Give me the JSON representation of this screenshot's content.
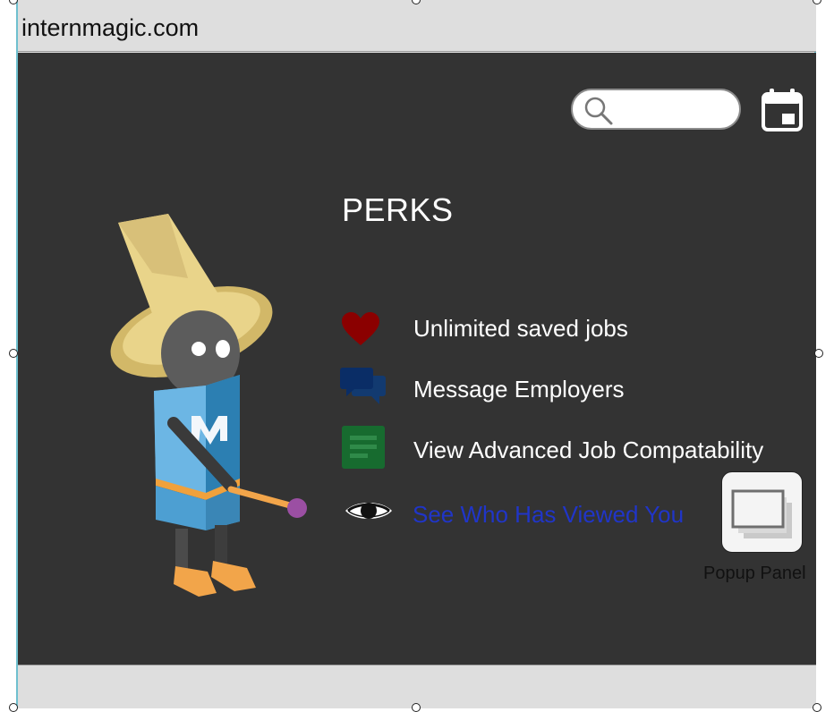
{
  "browser": {
    "url": "internmagic.com"
  },
  "header": {
    "search_icon": "magnifier-icon",
    "calendar_icon": "calendar-icon"
  },
  "perks": {
    "title": "PERKS",
    "items": [
      {
        "label": "Unlimited saved jobs",
        "icon": "heart-icon",
        "color": "#8b0000"
      },
      {
        "label": "Message Employers",
        "icon": "chat-bubbles-icon",
        "color": "#0a2d66"
      },
      {
        "label": "View Advanced Job Compatability",
        "icon": "document-icon",
        "color": "#176b2f"
      },
      {
        "label": "See Who Has Viewed You",
        "icon": "eye-icon",
        "color": "#2035c8",
        "is_link": true
      }
    ]
  },
  "popup_widget": {
    "label": "Popup Panel",
    "icon": "popup-panel-icon"
  },
  "colors": {
    "background": "#333333",
    "chrome": "#dedede",
    "frame": "#6fc0cf",
    "link": "#2035c8"
  }
}
